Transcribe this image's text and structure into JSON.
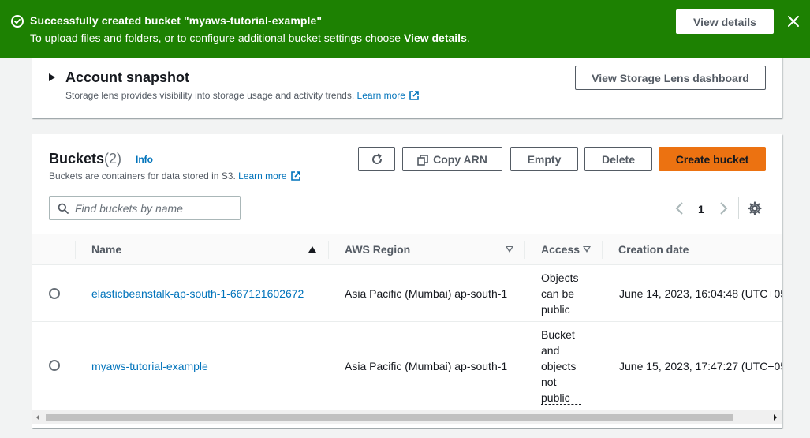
{
  "flash": {
    "title": "Successfully created bucket \"myaws-tutorial-example\"",
    "message_prefix": "To upload files and folders, or to configure additional bucket settings choose ",
    "message_bold": "View details",
    "message_suffix": ".",
    "view_details_label": "View details",
    "background": "#1d8102"
  },
  "snapshot": {
    "title": "Account snapshot",
    "description": "Storage lens provides visibility into storage usage and activity trends.",
    "learn_more": "Learn more",
    "lens_button": "View Storage Lens dashboard"
  },
  "buckets": {
    "title": "Buckets",
    "count": "(2)",
    "info": "Info",
    "description": "Buckets are containers for data stored in S3.",
    "learn_more": "Learn more",
    "actions": {
      "copy_arn": "Copy ARN",
      "empty": "Empty",
      "delete": "Delete",
      "create": "Create bucket"
    },
    "search_placeholder": "Find buckets by name",
    "page": "1",
    "columns": {
      "name": "Name",
      "region": "AWS Region",
      "access": "Access",
      "created": "Creation date"
    },
    "rows": [
      {
        "name": "elasticbeanstalk-ap-south-1-667121602672",
        "region": "Asia Pacific (Mumbai) ap-south-1",
        "access_lines": [
          "Objects",
          "can be",
          "public"
        ],
        "created": "June 14, 2023, 16:04:48 (UTC+05"
      },
      {
        "name": "myaws-tutorial-example",
        "region": "Asia Pacific (Mumbai) ap-south-1",
        "access_lines": [
          "Bucket",
          "and",
          "objects",
          "not",
          "public"
        ],
        "created": "June 15, 2023, 17:47:27 (UTC+05"
      }
    ]
  },
  "colors": {
    "primary_button": "#ec7211",
    "link": "#0073bb",
    "success": "#1d8102"
  }
}
